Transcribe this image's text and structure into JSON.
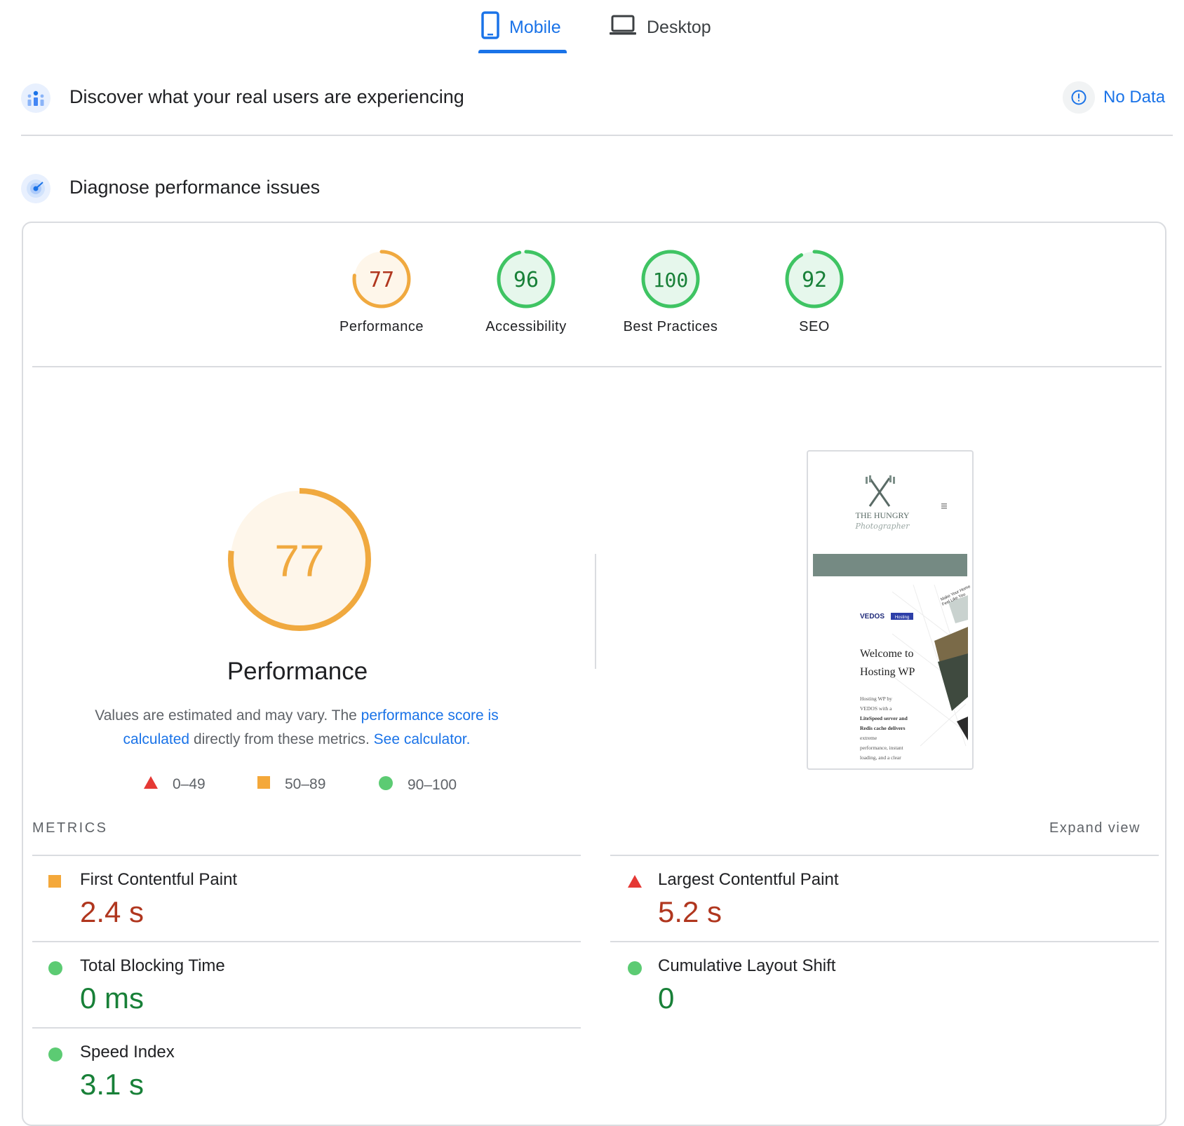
{
  "tabs": [
    {
      "label": "Mobile",
      "icon": "phone-icon",
      "active": true
    },
    {
      "label": "Desktop",
      "icon": "laptop-icon",
      "active": false
    }
  ],
  "field_data": {
    "title": "Discover what your real users are experiencing",
    "status": "No Data"
  },
  "diagnose": {
    "title": "Diagnose performance issues"
  },
  "scores": [
    {
      "label": "Performance",
      "value": 77,
      "rating": "average"
    },
    {
      "label": "Accessibility",
      "value": 96,
      "rating": "pass"
    },
    {
      "label": "Best Practices",
      "value": 100,
      "rating": "pass"
    },
    {
      "label": "SEO",
      "value": 92,
      "rating": "pass"
    }
  ],
  "performance": {
    "score": 77,
    "title": "Performance",
    "desc_1": "Values are estimated and may vary. The ",
    "link_1": "performance score is calculated",
    "desc_2": " directly from these metrics. ",
    "link_2": "See calculator."
  },
  "legend": [
    {
      "range": "0–49",
      "shape": "triangle",
      "color": "#e53935"
    },
    {
      "range": "50–89",
      "shape": "square",
      "color": "#f4a83a"
    },
    {
      "range": "90–100",
      "shape": "circle",
      "color": "#5ccb73"
    }
  ],
  "thumbnail": {
    "brand_1": "THE HUNGRY",
    "brand_2": "Photographer",
    "badge": "VEDOS",
    "badge_tag": "Hosting",
    "side_text_1": "Make Your Home",
    "side_text_2": "Feel Like You",
    "headline_1": "Welcome to",
    "headline_2": "Hosting WP",
    "body_1": "Hosting WP by",
    "body_2": "VEDOS with a",
    "body_3": "LiteSpeed server and",
    "body_4": "Redis cache delivers",
    "body_5": "extreme",
    "body_6": "performance, instant",
    "body_7": "loading, and a clear"
  },
  "metrics_header": "METRICS",
  "expand_label": "Expand view",
  "metrics": [
    {
      "name": "First Contentful Paint",
      "value": "2.4 s",
      "rating": "average"
    },
    {
      "name": "Largest Contentful Paint",
      "value": "5.2 s",
      "rating": "fail"
    },
    {
      "name": "Total Blocking Time",
      "value": "0 ms",
      "rating": "pass"
    },
    {
      "name": "Cumulative Layout Shift",
      "value": "0",
      "rating": "pass"
    },
    {
      "name": "Speed Index",
      "value": "3.1 s",
      "rating": "pass"
    }
  ],
  "colors": {
    "accent": "#1a73e8",
    "average": "#f0a93f",
    "pass": "#0cce6b",
    "fail": "#e53935",
    "average_text": "#b0361e",
    "pass_text": "#188038"
  }
}
